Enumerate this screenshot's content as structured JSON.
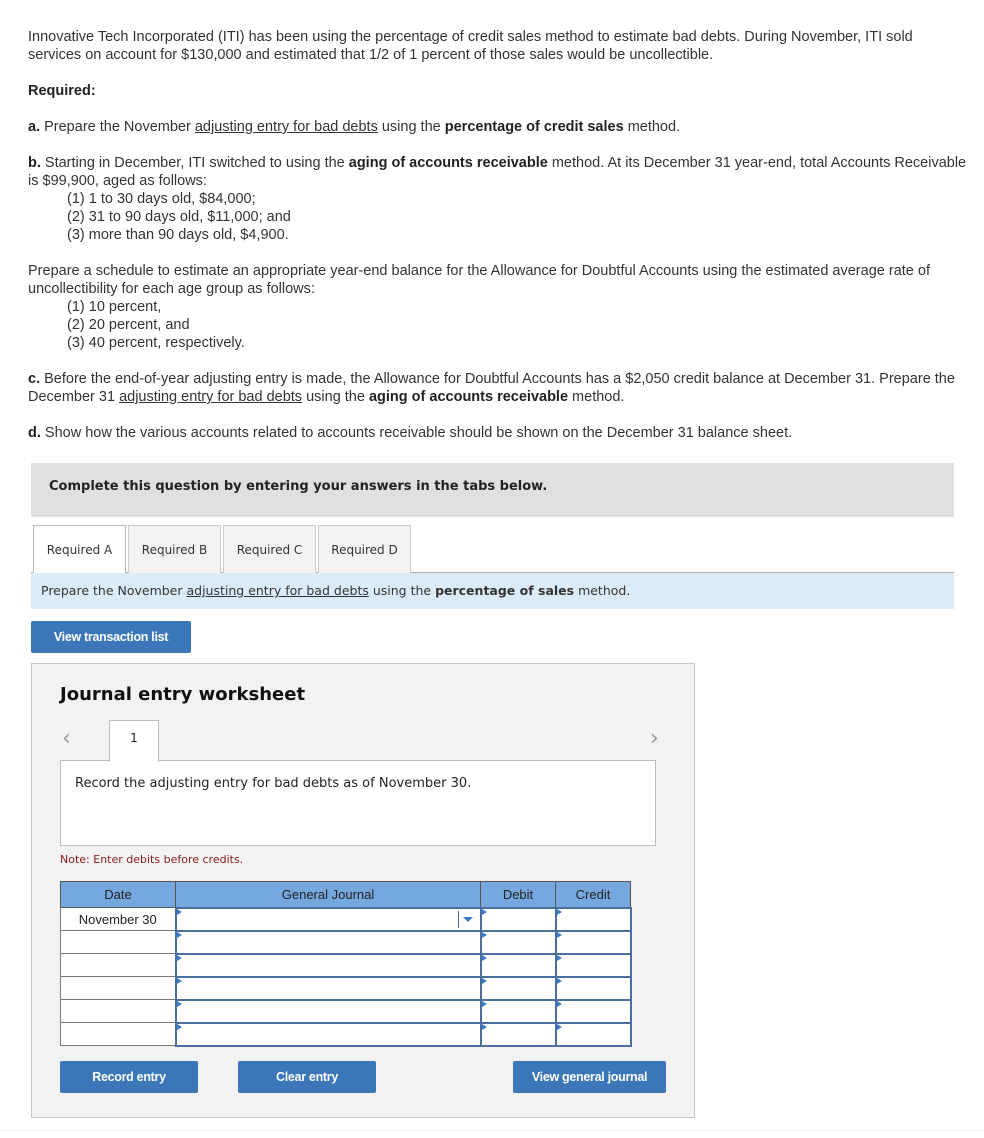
{
  "problem": {
    "intro": "Innovative Tech Incorporated (ITI) has been using the percentage of credit sales method to estimate bad debts. During November, ITI sold services on account for $130,000 and estimated that 1/2 of 1 percent of those sales would be uncollectible.",
    "required_label": "Required:",
    "a": {
      "prefix": "a.",
      "text1": " Prepare the November ",
      "link": "adjusting entry for bad debts",
      "text2": " using the ",
      "bold": "percentage of credit sales",
      "text3": " method."
    },
    "b": {
      "prefix": "b.",
      "text1": " Starting in December, ITI switched to using the ",
      "bold": "aging of accounts receivable",
      "text2": " method. At its December 31 year-end, total Accounts Receivable is $99,900, aged as follows:",
      "items": [
        "(1) 1 to 30 days old, $84,000;",
        "(2) 31 to 90 days old, $11,000; and",
        "(3) more than 90 days old, $4,900."
      ]
    },
    "schedule": {
      "text": "Prepare a schedule to estimate an appropriate year-end balance for the Allowance for Doubtful Accounts using the estimated average rate of uncollectibility for each age group as follows:",
      "items": [
        "(1) 10 percent,",
        "(2) 20 percent, and",
        "(3) 40 percent, respectively."
      ]
    },
    "c": {
      "prefix": "c.",
      "text1": " Before the end-of-year adjusting entry is made, the Allowance for Doubtful Accounts has a $2,050 credit balance at December 31. Prepare the December 31 ",
      "link": "adjusting entry for bad debts",
      "text2": " using the ",
      "bold": "aging of accounts receivable",
      "text3": " method."
    },
    "d": {
      "prefix": "d.",
      "text": " Show how the various accounts related to accounts receivable should be shown on the December 31 balance sheet."
    }
  },
  "banner": "Complete this question by entering your answers in the tabs below.",
  "tabs": [
    {
      "label": "Required A",
      "active": true
    },
    {
      "label": "Required B",
      "active": false
    },
    {
      "label": "Required C",
      "active": false
    },
    {
      "label": "Required D",
      "active": false
    }
  ],
  "instruction": {
    "text1": "Prepare the November ",
    "link": "adjusting entry for bad debts",
    "text2": " using the ",
    "bold": "percentage of sales",
    "text3": " method."
  },
  "view_transaction_list": "View transaction list",
  "worksheet": {
    "title": "Journal entry worksheet",
    "prev_icon": "‹",
    "next_icon": "›",
    "page_tab": "1",
    "description": "Record the adjusting entry for bad debts as of November 30.",
    "note": "Note: Enter debits before credits.",
    "columns": [
      "Date",
      "General Journal",
      "Debit",
      "Credit"
    ],
    "rows": [
      {
        "date": "November 30",
        "account": "",
        "debit": "",
        "credit": ""
      },
      {
        "date": "",
        "account": "",
        "debit": "",
        "credit": ""
      },
      {
        "date": "",
        "account": "",
        "debit": "",
        "credit": ""
      },
      {
        "date": "",
        "account": "",
        "debit": "",
        "credit": ""
      },
      {
        "date": "",
        "account": "",
        "debit": "",
        "credit": ""
      },
      {
        "date": "",
        "account": "",
        "debit": "",
        "credit": ""
      }
    ],
    "buttons": {
      "record": "Record entry",
      "clear": "Clear entry",
      "view_journal": "View general journal"
    }
  }
}
